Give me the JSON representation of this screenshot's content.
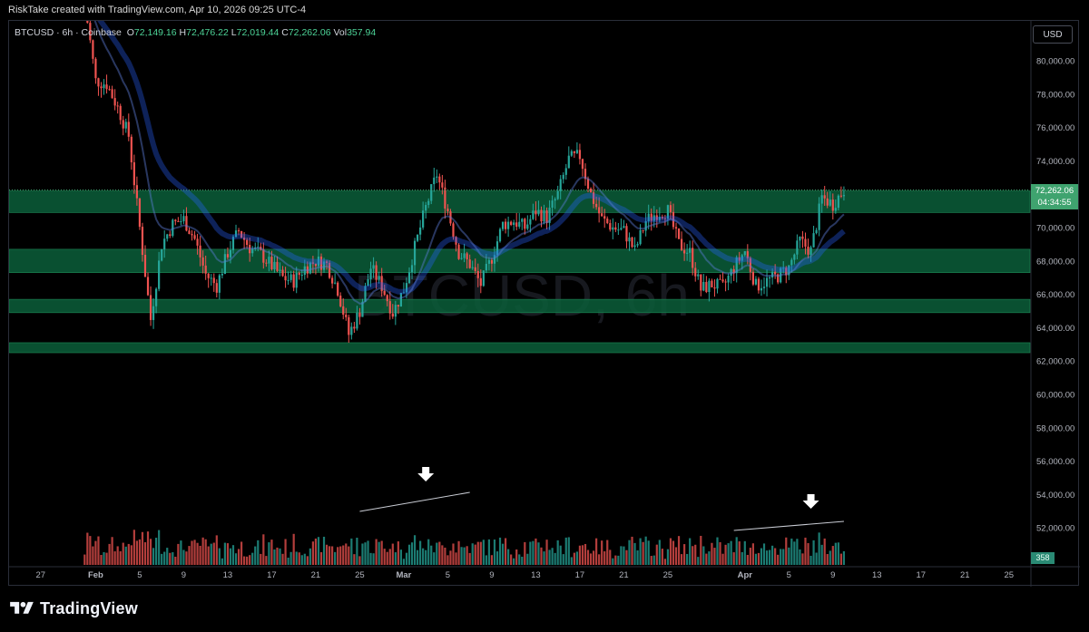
{
  "attribution": "RiskTake created with TradingView.com, Apr 10, 2026 09:25 UTC-4",
  "legend": {
    "symbol": "BTCUSD · 6h · Coinbase",
    "open_label": "O",
    "open": "72,149.16",
    "high_label": "H",
    "high": "72,476.22",
    "low_label": "L",
    "low": "72,019.44",
    "close_label": "C",
    "close": "72,262.06",
    "vol_label": "Vol",
    "vol": "357.94"
  },
  "watermark": "BTCUSD, 6h",
  "currency_button": "USD",
  "last_price_tag": {
    "price": "72,262.06",
    "countdown": "04:34:55"
  },
  "volume_tag": "358",
  "footer_brand": "TradingView",
  "colors": {
    "up": "#26a69a",
    "down": "#ef5350",
    "zone": "#0b5e3a",
    "ema": "#2962ff",
    "background": "#000000"
  },
  "chart_data": {
    "type": "candlestick",
    "symbol": "BTCUSD",
    "interval": "6h",
    "exchange": "Coinbase",
    "y_axis": {
      "min": 60000,
      "max": 80000,
      "tick_labels": [
        "80,000.00",
        "78,000.00",
        "76,000.00",
        "74,000.00",
        "72,000.00",
        "70,000.00",
        "68,000.00",
        "66,000.00",
        "64,000.00",
        "62,000.00",
        "60,000.00",
        "58,000.00",
        "56,000.00",
        "54,000.00",
        "52,000.00"
      ]
    },
    "x_axis": {
      "tick_labels": [
        "27",
        "Feb",
        "5",
        "9",
        "13",
        "17",
        "21",
        "25",
        "Mar",
        "5",
        "9",
        "13",
        "17",
        "21",
        "25",
        "Apr",
        "5",
        "9",
        "13",
        "17",
        "21",
        "25"
      ]
    },
    "support_resistance_zones": [
      {
        "low": 70900,
        "high": 72200
      },
      {
        "low": 67300,
        "high": 68700
      },
      {
        "low": 64900,
        "high": 65700
      },
      {
        "low": 62500,
        "high": 63100
      }
    ],
    "price_path": [
      {
        "date": "2026-01-31",
        "price": 83500
      },
      {
        "date": "2026-02-01",
        "price": 78800
      },
      {
        "date": "2026-02-02",
        "price": 78600
      },
      {
        "date": "2026-02-03",
        "price": 77200
      },
      {
        "date": "2026-02-04",
        "price": 75500
      },
      {
        "date": "2026-02-05",
        "price": 70000
      },
      {
        "date": "2026-02-06",
        "price": 64500
      },
      {
        "date": "2026-02-07",
        "price": 69000
      },
      {
        "date": "2026-02-08",
        "price": 70200
      },
      {
        "date": "2026-02-09",
        "price": 70500
      },
      {
        "date": "2026-02-10",
        "price": 69300
      },
      {
        "date": "2026-02-11",
        "price": 67200
      },
      {
        "date": "2026-02-12",
        "price": 66500
      },
      {
        "date": "2026-02-13",
        "price": 68500
      },
      {
        "date": "2026-02-14",
        "price": 69800
      },
      {
        "date": "2026-02-15",
        "price": 68800
      },
      {
        "date": "2026-02-16",
        "price": 68400
      },
      {
        "date": "2026-02-17",
        "price": 67700
      },
      {
        "date": "2026-02-18",
        "price": 67000
      },
      {
        "date": "2026-02-19",
        "price": 66800
      },
      {
        "date": "2026-02-20",
        "price": 67600
      },
      {
        "date": "2026-02-21",
        "price": 68000
      },
      {
        "date": "2026-02-22",
        "price": 67800
      },
      {
        "date": "2026-02-23",
        "price": 66300
      },
      {
        "date": "2026-02-24",
        "price": 63600
      },
      {
        "date": "2026-02-25",
        "price": 65000
      },
      {
        "date": "2026-02-26",
        "price": 67600
      },
      {
        "date": "2026-02-27",
        "price": 66500
      },
      {
        "date": "2026-02-28",
        "price": 64900
      },
      {
        "date": "2026-03-01",
        "price": 66300
      },
      {
        "date": "2026-03-02",
        "price": 68800
      },
      {
        "date": "2026-03-03",
        "price": 71200
      },
      {
        "date": "2026-03-04",
        "price": 73200
      },
      {
        "date": "2026-03-05",
        "price": 71000
      },
      {
        "date": "2026-03-06",
        "price": 68500
      },
      {
        "date": "2026-03-07",
        "price": 67800
      },
      {
        "date": "2026-03-08",
        "price": 66600
      },
      {
        "date": "2026-03-09",
        "price": 68200
      },
      {
        "date": "2026-03-10",
        "price": 70200
      },
      {
        "date": "2026-03-11",
        "price": 70400
      },
      {
        "date": "2026-03-12",
        "price": 70000
      },
      {
        "date": "2026-03-13",
        "price": 71000
      },
      {
        "date": "2026-03-14",
        "price": 70600
      },
      {
        "date": "2026-03-15",
        "price": 72000
      },
      {
        "date": "2026-03-16",
        "price": 74100
      },
      {
        "date": "2026-03-17",
        "price": 74300
      },
      {
        "date": "2026-03-18",
        "price": 72000
      },
      {
        "date": "2026-03-19",
        "price": 70500
      },
      {
        "date": "2026-03-20",
        "price": 70000
      },
      {
        "date": "2026-03-21",
        "price": 69800
      },
      {
        "date": "2026-03-22",
        "price": 68600
      },
      {
        "date": "2026-03-23",
        "price": 70400
      },
      {
        "date": "2026-03-24",
        "price": 70900
      },
      {
        "date": "2026-03-25",
        "price": 71000
      },
      {
        "date": "2026-03-26",
        "price": 69000
      },
      {
        "date": "2026-03-27",
        "price": 68500
      },
      {
        "date": "2026-03-28",
        "price": 66300
      },
      {
        "date": "2026-03-29",
        "price": 66600
      },
      {
        "date": "2026-03-30",
        "price": 66400
      },
      {
        "date": "2026-03-31",
        "price": 67600
      },
      {
        "date": "2026-04-01",
        "price": 68600
      },
      {
        "date": "2026-04-02",
        "price": 66500
      },
      {
        "date": "2026-04-03",
        "price": 66800
      },
      {
        "date": "2026-04-04",
        "price": 67100
      },
      {
        "date": "2026-04-05",
        "price": 67600
      },
      {
        "date": "2026-04-06",
        "price": 69200
      },
      {
        "date": "2026-04-07",
        "price": 68600
      },
      {
        "date": "2026-04-08",
        "price": 71800
      },
      {
        "date": "2026-04-09",
        "price": 71400
      },
      {
        "date": "2026-04-10",
        "price": 72262
      }
    ],
    "volume_annotations": [
      {
        "type": "rising-trendline",
        "start_date": "2026-02-25",
        "end_date": "2026-03-07",
        "arrow_date": "2026-03-03"
      },
      {
        "type": "rising-trendline",
        "start_date": "2026-03-31",
        "end_date": "2026-04-10",
        "arrow_date": "2026-04-07"
      }
    ]
  }
}
